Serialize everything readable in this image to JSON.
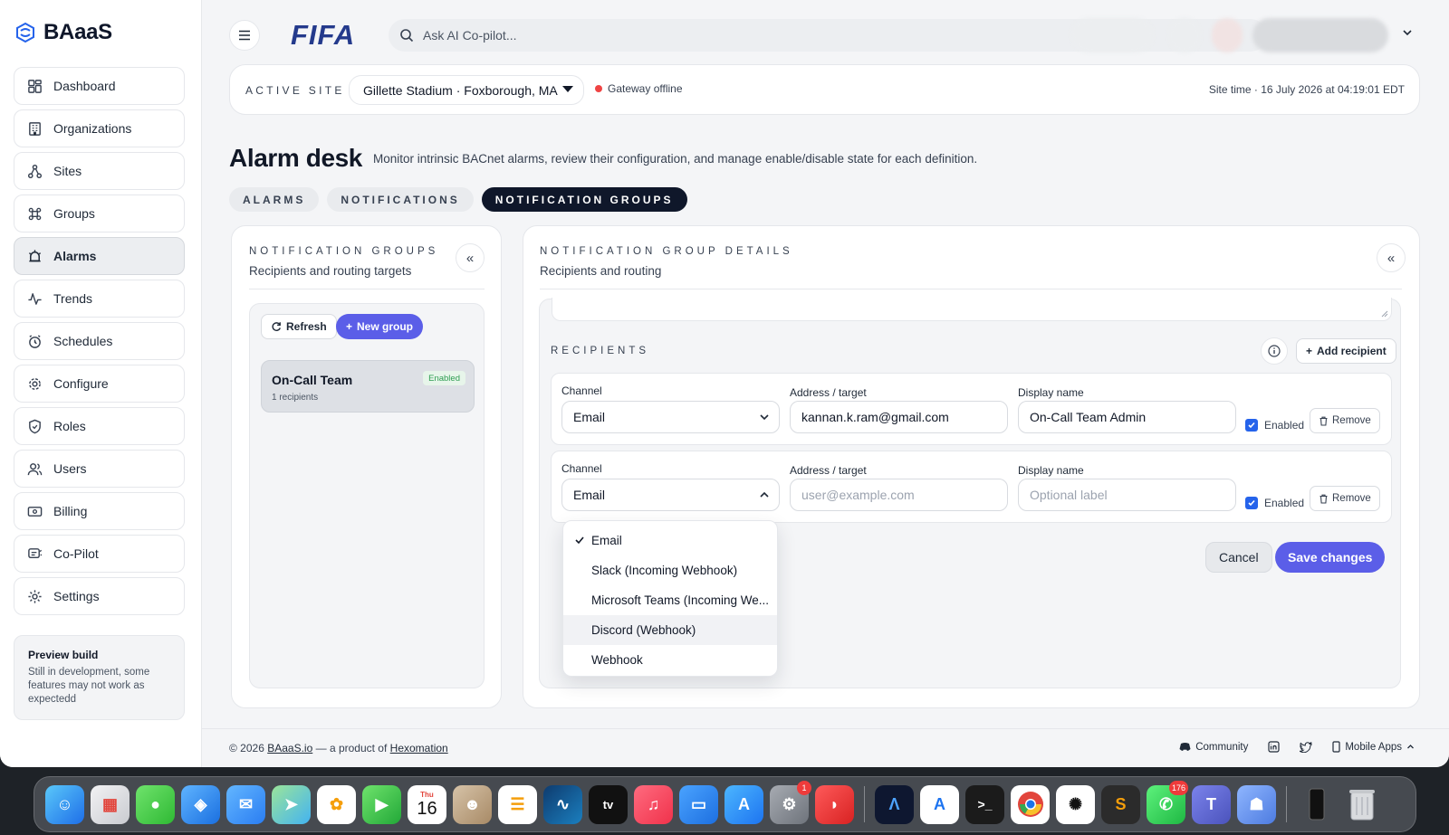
{
  "brand": {
    "name": "BAaaS"
  },
  "sidebar": {
    "items": [
      {
        "label": "Dashboard",
        "icon": "dashboard-icon"
      },
      {
        "label": "Organizations",
        "icon": "building-icon"
      },
      {
        "label": "Sites",
        "icon": "sites-icon"
      },
      {
        "label": "Groups",
        "icon": "groups-icon"
      },
      {
        "label": "Alarms",
        "icon": "alarm-icon",
        "active": true
      },
      {
        "label": "Trends",
        "icon": "trends-icon"
      },
      {
        "label": "Schedules",
        "icon": "clock-icon"
      },
      {
        "label": "Configure",
        "icon": "gear-icon"
      },
      {
        "label": "Roles",
        "icon": "shield-icon"
      },
      {
        "label": "Users",
        "icon": "users-icon"
      },
      {
        "label": "Billing",
        "icon": "billing-icon"
      },
      {
        "label": "Co-Pilot",
        "icon": "copilot-icon"
      },
      {
        "label": "Settings",
        "icon": "settings-icon"
      }
    ],
    "preview": {
      "title": "Preview build",
      "body": "Still in development, some features may not work as expectedd"
    }
  },
  "topbar": {
    "logo": "FIFA",
    "search_placeholder": "Ask AI Co-pilot..."
  },
  "site": {
    "label": "ACTIVE SITE",
    "selected": "Gillette Stadium · Foxborough, MA",
    "gateway_status": "Gateway offline",
    "site_time": "Site time · 16 July 2026 at 04:19:01 EDT"
  },
  "page": {
    "title": "Alarm desk",
    "description": "Monitor intrinsic BACnet alarms, review their configuration, and manage enable/disable state for each definition.",
    "tabs": [
      "ALARMS",
      "NOTIFICATIONS",
      "NOTIFICATION GROUPS"
    ]
  },
  "groups_panel": {
    "kicker": "NOTIFICATION GROUPS",
    "subtitle": "Recipients and routing targets",
    "refresh_label": "Refresh",
    "new_group_label": "New group",
    "groups": [
      {
        "name": "On-Call Team",
        "meta": "1 recipients",
        "status": "Enabled"
      }
    ]
  },
  "details_panel": {
    "kicker": "NOTIFICATION GROUP DETAILS",
    "subtitle": "Recipients and routing",
    "recipients_label": "RECIPIENTS",
    "add_recipient_label": "Add recipient",
    "labels": {
      "channel": "Channel",
      "address": "Address / target",
      "display": "Display name",
      "enabled": "Enabled",
      "remove": "Remove"
    },
    "recipients": [
      {
        "channel": "Email",
        "address": "kannan.k.ram@gmail.com",
        "display": "On-Call Team Admin",
        "enabled": true
      },
      {
        "channel": "Email",
        "address_placeholder": "user@example.com",
        "display_placeholder": "Optional label",
        "enabled": true
      }
    ],
    "channel_options": [
      "Email",
      "Slack (Incoming Webhook)",
      "Microsoft Teams (Incoming We...",
      "Discord (Webhook)",
      "Webhook"
    ],
    "cancel_label": "Cancel",
    "save_label": "Save changes"
  },
  "footer": {
    "copyright": "© 2026",
    "link1": "BAaaS.io",
    "middle": "— a product of",
    "link2": "Hexomation",
    "community": "Community",
    "mobile_apps": "Mobile Apps"
  },
  "dock": {
    "calendar_month": "Thu",
    "calendar_day": "16",
    "badges": {
      "settings": "1",
      "whatsapp": "176"
    }
  },
  "colors": {
    "accent": "#5b5ee8",
    "dark_tab": "#0f172a",
    "offline": "#ef4444",
    "enabled_badge": "#2f9e52"
  }
}
